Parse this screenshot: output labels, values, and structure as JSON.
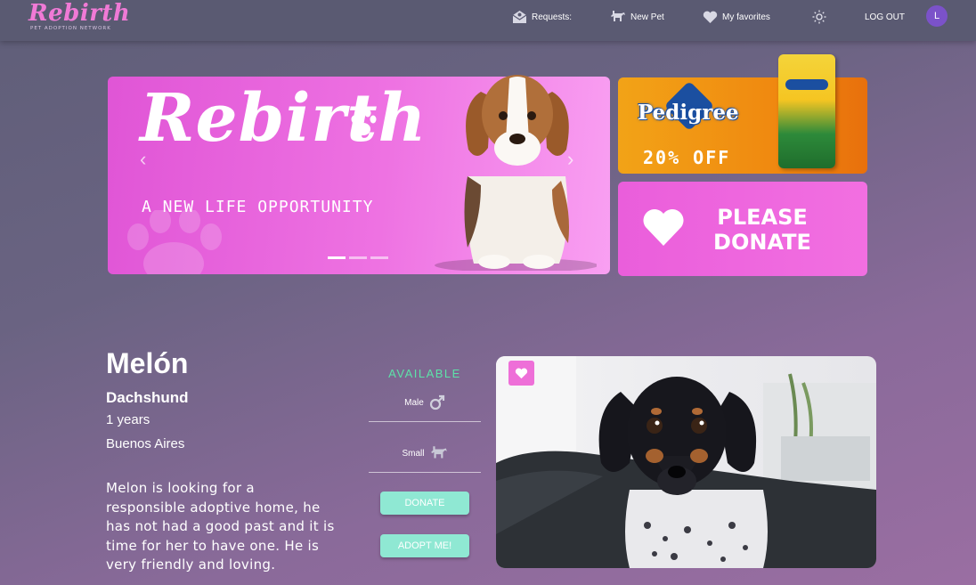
{
  "brand": {
    "logo": "Rebirth",
    "subtitle": "PET ADOPTION NETWORK"
  },
  "nav": {
    "requests": "Requests:",
    "new_pet": "New Pet",
    "favorites": "My favorites",
    "logout": "LOG OUT",
    "avatar_initial": "L"
  },
  "carousel": {
    "title": "Rebirth",
    "tagline": "A NEW LIFE OPPORTUNITY",
    "slides": 3,
    "active_slide": 1
  },
  "ads": {
    "pedigree_brand": "Pedigree",
    "pedigree_offer": "20% OFF",
    "donate_line1": "PLEASE",
    "donate_line2": "DONATE"
  },
  "pet": {
    "name": "Melón",
    "breed": "Dachshund",
    "age": "1 years",
    "location": "Buenos Aires",
    "description": "Melon is looking for a responsible adoptive home, he has not had a good past and it is time for her to have one. He is very friendly and loving.",
    "status": "AVAILABLE",
    "sex": "Male",
    "size": "Small",
    "donate_button": "DONATE",
    "adopt_button": "ADOPT ME!"
  },
  "colors": {
    "nav_bg": "#5a5a72",
    "brand_pink": "#f07ad6",
    "status_green": "#5de2a8",
    "button_teal": "#8fe8d3",
    "avatar_purple": "#7b52c9"
  }
}
